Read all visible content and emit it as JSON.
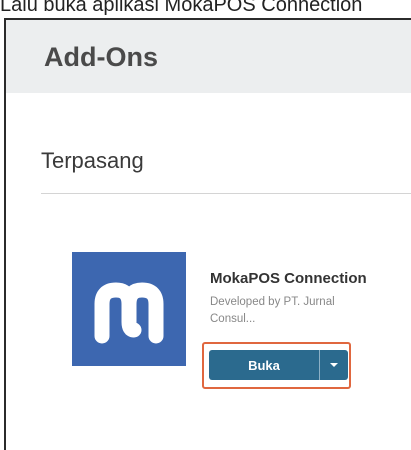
{
  "caption": "Lalu buka aplikasi MokaPOS Connection",
  "header": {
    "title": "Add-Ons"
  },
  "section": {
    "title": "Terpasang"
  },
  "addon": {
    "name": "MokaPOS Connection",
    "developer": "Developed by PT. Jurnal Consul...",
    "logo_icon": "moka-logo-icon",
    "logo_color": "#3d67b0",
    "open_label": "Buka",
    "dropdown_icon": "caret-down-icon",
    "button_color": "#2b6a8e",
    "highlight_color": "#e0673f"
  }
}
